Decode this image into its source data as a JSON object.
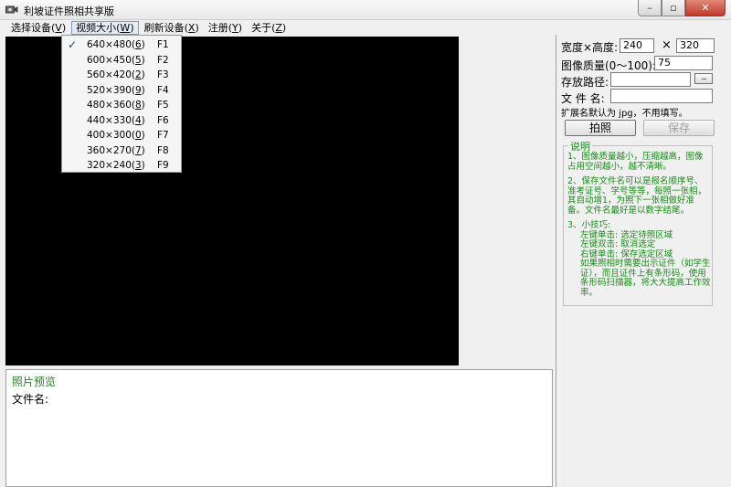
{
  "window": {
    "title": "利坡证件照相共享版",
    "icon": "camera-icon",
    "buttons": {
      "minimize": "–",
      "maximize": "▫",
      "close": "✕"
    }
  },
  "menubar": {
    "items": [
      {
        "label": "选择设备(",
        "key": "V",
        "suffix": ")"
      },
      {
        "label": "视频大小(",
        "key": "W",
        "suffix": ")"
      },
      {
        "label": "刷新设备(",
        "key": "X",
        "suffix": ")"
      },
      {
        "label": "注册(",
        "key": "Y",
        "suffix": ")"
      },
      {
        "label": "关于(",
        "key": "Z",
        "suffix": ")"
      }
    ]
  },
  "video_size_menu": {
    "check_glyph": "✓",
    "items": [
      {
        "label": "640×480(",
        "key": "6",
        "suffix": ")",
        "shortcut": "F1",
        "checked": true
      },
      {
        "label": "600×450(",
        "key": "5",
        "suffix": ")",
        "shortcut": "F2",
        "checked": false
      },
      {
        "label": "560×420(",
        "key": "2",
        "suffix": ")",
        "shortcut": "F3",
        "checked": false
      },
      {
        "label": "520×390(",
        "key": "9",
        "suffix": ")",
        "shortcut": "F4",
        "checked": false
      },
      {
        "label": "480×360(",
        "key": "8",
        "suffix": ")",
        "shortcut": "F5",
        "checked": false
      },
      {
        "label": "440×330(",
        "key": "4",
        "suffix": ")",
        "shortcut": "F6",
        "checked": false
      },
      {
        "label": "400×300(",
        "key": "0",
        "suffix": ")",
        "shortcut": "F7",
        "checked": false
      },
      {
        "label": "360×270(",
        "key": "7",
        "suffix": ")",
        "shortcut": "F8",
        "checked": false
      },
      {
        "label": "320×240(",
        "key": "3",
        "suffix": ")",
        "shortcut": "F9",
        "checked": false
      }
    ]
  },
  "settings": {
    "size_label": "宽度×高度:",
    "width_value": "240",
    "times": "×",
    "height_value": "320",
    "quality_label": "图像质量(0～100):",
    "quality_value": "75",
    "path_label": "存放路径:",
    "path_value": "",
    "browse_label": "...",
    "filename_label": "文 件 名:",
    "filename_value": "",
    "hint": "扩展名默认为 jpg，不用填写。",
    "capture_button": "拍照",
    "save_button": "保存"
  },
  "instructions": {
    "title": "说明",
    "p1": "1、图像质量越小，压缩越高，图像占用空间越小，越不清晰。",
    "p2": "2、保存文件名可以是报名顺序号、准考证号、学号等等，每照一张相，其自动增1，为照下一张相做好准备。文件名最好是以数字结尾。",
    "p3": "3、小技巧:",
    "tip1": "左键单击: 选定待照区域",
    "tip2": "左键双击: 取消选定",
    "tip3": "右键单击: 保存选定区域",
    "tip4": "如果照相时需要出示证件（如学生证），而且证件上有条形码，使用条形码扫描器，将大大提高工作效率。"
  },
  "preview": {
    "title": "照片预览",
    "filename_label": "文件名:"
  },
  "colors": {
    "accent_green": "#1a8a1a",
    "video_bg": "#000000",
    "window_bg": "#f0f0f0"
  }
}
